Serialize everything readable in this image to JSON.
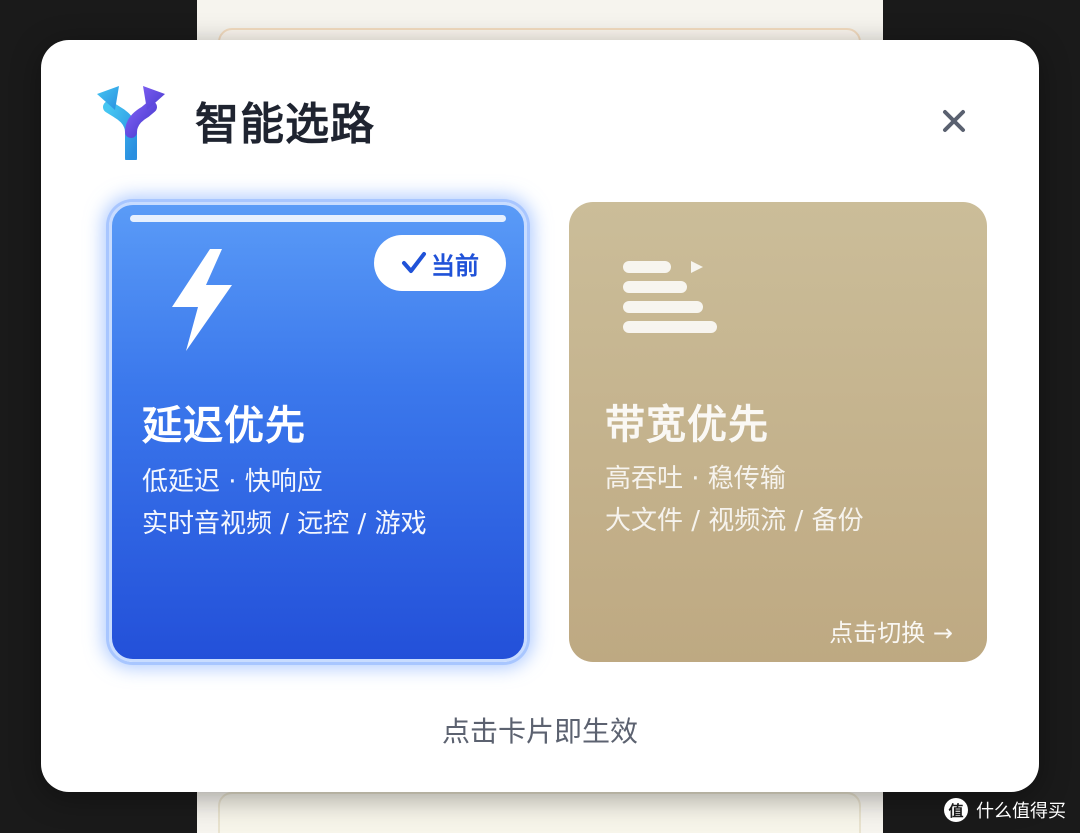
{
  "modal": {
    "title": "智能选路",
    "close_label": "×",
    "footer_hint": "点击卡片即生效"
  },
  "cards": [
    {
      "title": "延迟优先",
      "line1": "低延迟 · 快响应",
      "line2": "实时音视频 / 远控 / 游戏",
      "badge": "当前",
      "icon": "lightning-icon",
      "selected": true
    },
    {
      "title": "带宽优先",
      "line1": "高吞吐 · 稳传输",
      "line2": "大文件 / 视频流 / 备份",
      "action": "点击切换 →",
      "icon": "stream-bars-icon",
      "selected": false
    }
  ],
  "watermark": {
    "text": "什么值得买",
    "icon_char": "值"
  },
  "colors": {
    "latency_card": "#3b78ec",
    "bandwidth_card": "#c6b58f",
    "badge_text": "#2052d8",
    "title_text": "#1f2430"
  }
}
